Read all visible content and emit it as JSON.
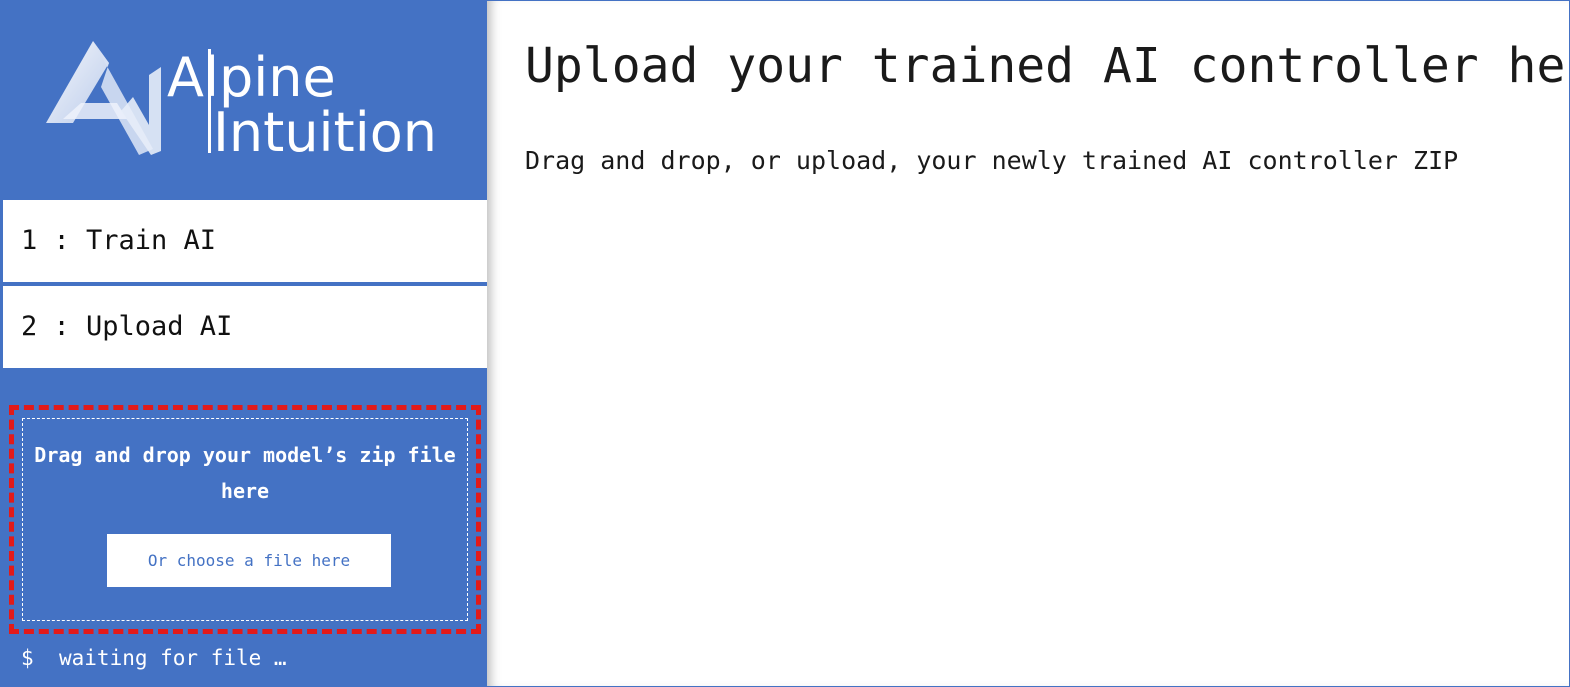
{
  "brand": {
    "logo_line1": "Alpine",
    "logo_line2": "Intuition",
    "logo_icon": "alpine-mountain-logo-icon"
  },
  "sidebar": {
    "nav": [
      {
        "label": "1 : Train AI"
      },
      {
        "label": "2 : Upload AI"
      }
    ],
    "dropzone": {
      "text": "Drag and drop your model’s zip file here",
      "button_label": "Or choose a file here"
    },
    "status": {
      "prompt": "$",
      "text": "waiting for file …"
    }
  },
  "main": {
    "title": "Upload your trained AI controller he",
    "description": "Drag and drop, or upload, your newly trained AI controller ZIP"
  },
  "colors": {
    "sidebar_bg": "#4472c4",
    "dropzone_border": "#e21a1a",
    "text_dark": "#1a1a1a",
    "white": "#ffffff"
  }
}
